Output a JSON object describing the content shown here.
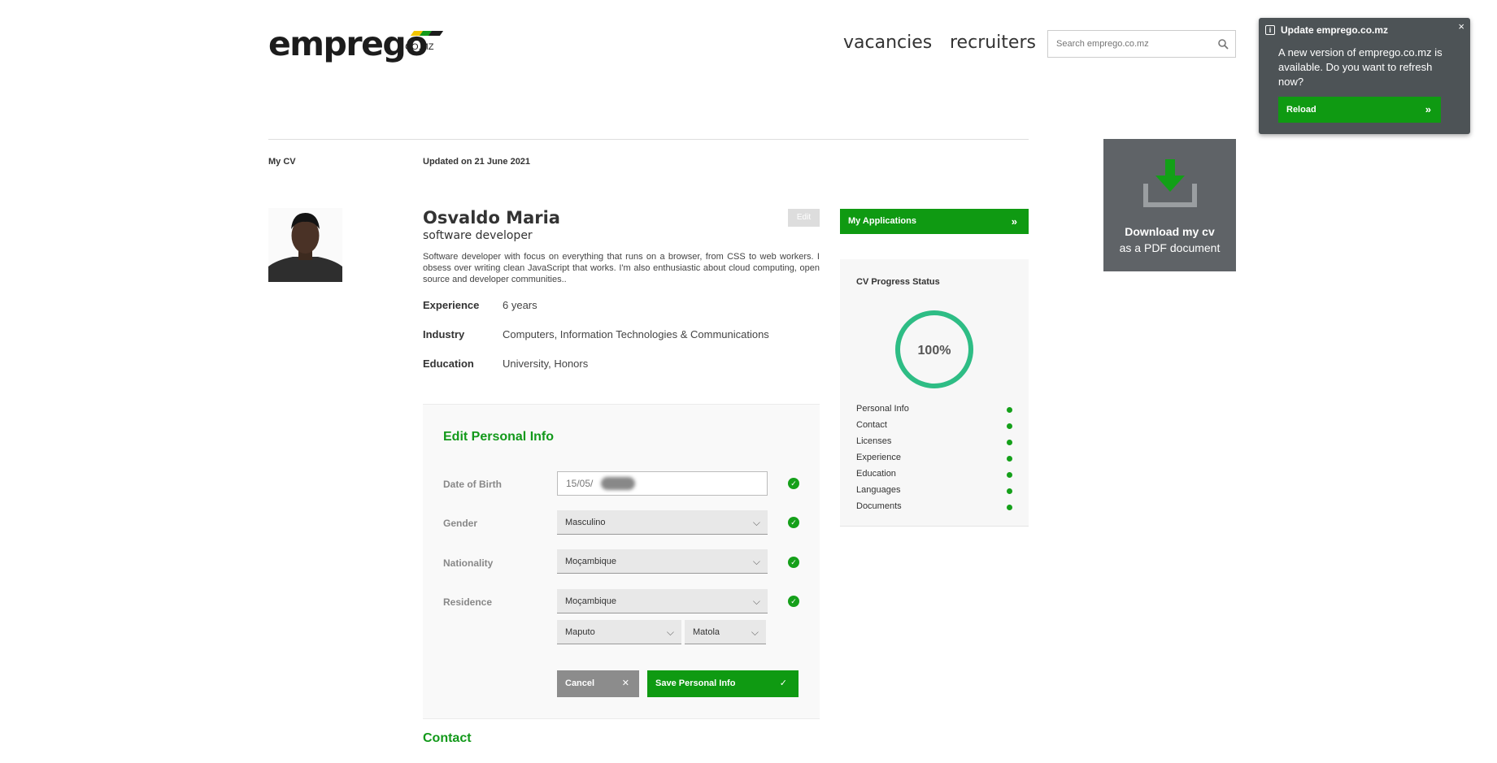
{
  "header": {
    "logo": "emprego",
    "logo_domain": "CO.MZ",
    "logo_colors": [
      "#f2c500",
      "#12991a",
      "#1c1c1c"
    ],
    "nav": [
      "vacancies",
      "recruiters"
    ],
    "search_placeholder": "Search emprego.co.mz"
  },
  "notification": {
    "title": "Update emprego.co.mz",
    "message": "A new version of emprego.co.mz is available. Do you want to refresh now?",
    "button": "Reload",
    "close": "×"
  },
  "breadcrumb": {
    "section": "My CV",
    "updated": "Updated on 21 June 2021"
  },
  "download": {
    "line1": "Download my cv",
    "line2": "as a PDF document"
  },
  "profile": {
    "name": "Osvaldo Maria",
    "role": "software developer",
    "edit": "Edit",
    "bio": "Software developer with focus on everything that runs on a browser, from CSS to web workers. I obsess over writing clean JavaScript that works. I'm also enthusiastic about cloud computing, open source and developer communities..",
    "facts": [
      {
        "label": "Experience",
        "value": "6 years"
      },
      {
        "label": "Industry",
        "value": "Computers, Information Technologies & Communications"
      },
      {
        "label": "Education",
        "value": "University, Honors"
      }
    ]
  },
  "applications": {
    "label": "My Applications"
  },
  "progress": {
    "title": "CV Progress Status",
    "percent": 100,
    "percent_label": "100%",
    "accent": "#2ebd85",
    "items": [
      "Personal Info",
      "Contact",
      "Licenses",
      "Experience",
      "Education",
      "Languages",
      "Documents"
    ]
  },
  "form": {
    "title": "Edit Personal Info",
    "dob_label": "Date of Birth",
    "dob_value": "15/05/",
    "gender_label": "Gender",
    "gender_value": "Masculino",
    "nationality_label": "Nationality",
    "nationality_value": "Moçambique",
    "residence_label": "Residence",
    "residence_value": "Moçambique",
    "province_value": "Maputo",
    "city_value": "Matola",
    "cancel": "Cancel",
    "save": "Save Personal Info"
  },
  "contact_heading": "Contact",
  "colors": {
    "brand_green": "#0f9a12",
    "panel_grey": "#5f6367"
  }
}
